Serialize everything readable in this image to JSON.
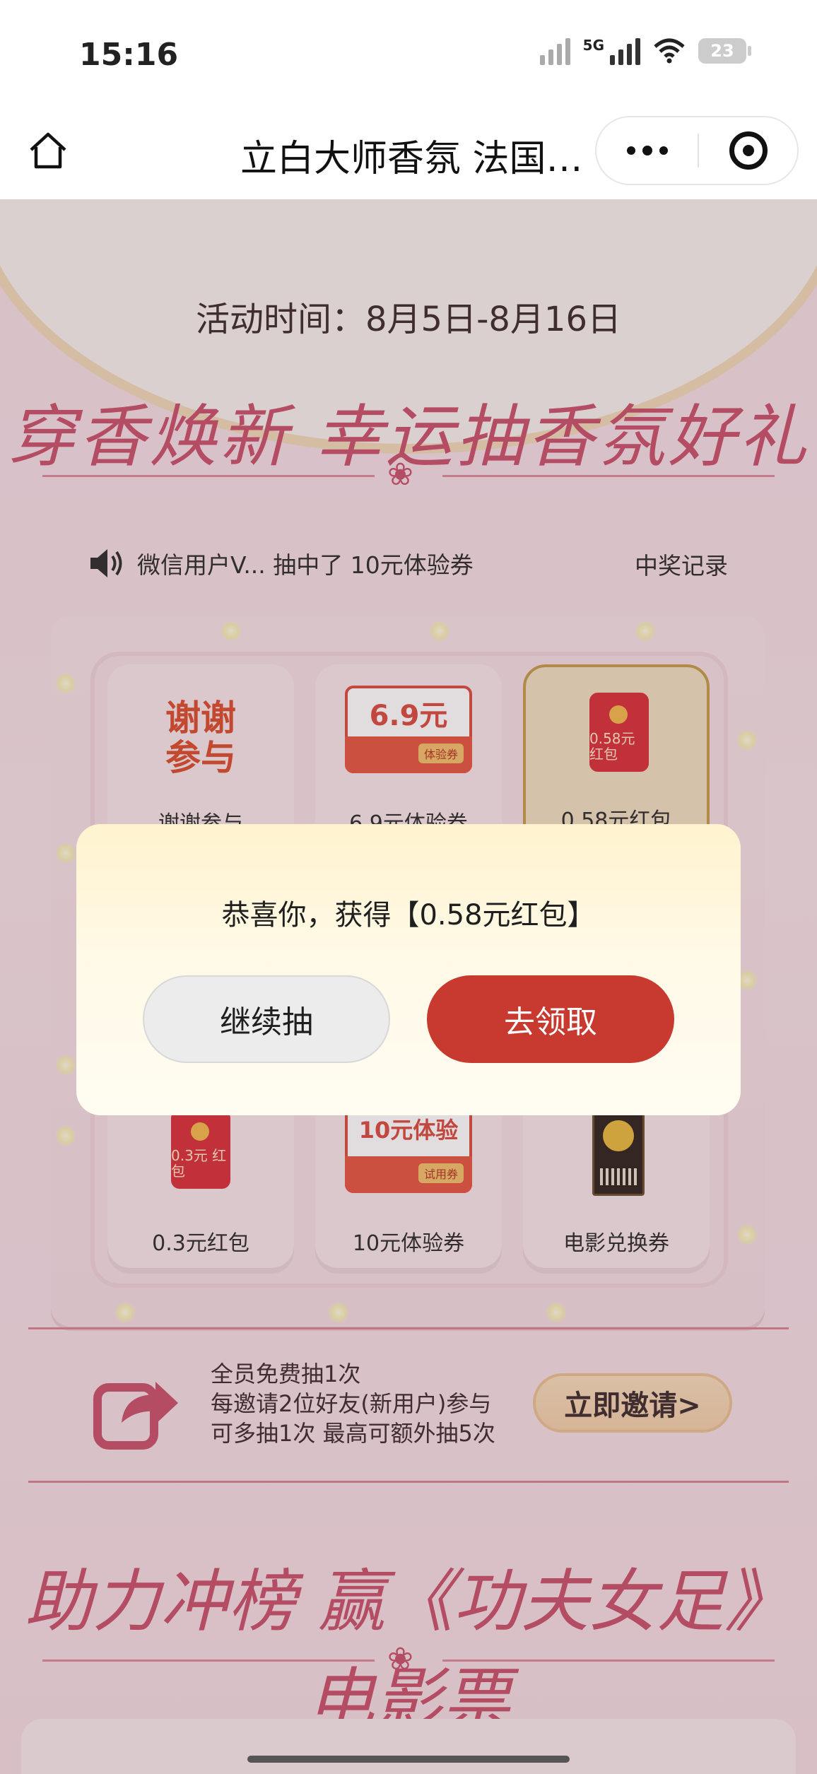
{
  "status_bar": {
    "time": "15:16",
    "network": "5G",
    "battery": "23"
  },
  "nav": {
    "title": "立白大师香氛 法国…"
  },
  "campaign": {
    "period": "活动时间：8月5日-8月16日",
    "slogan": "穿香焕新 幸运抽香氛好礼",
    "ticker": "微信用户V...  抽中了  10元体验券",
    "records_link": "中奖记录"
  },
  "prizes": {
    "thanks_art": "谢谢参与",
    "cells": [
      {
        "label": "谢谢参与"
      },
      {
        "label": "6.9元体验券",
        "amount": "6.9元",
        "tag": "体验券"
      },
      {
        "label": "0.58元红包",
        "art": "0.58元 红包"
      },
      {
        "label": "0.3元红包",
        "art": "0.3元 红包"
      },
      {
        "label": "10元体验券",
        "amount": "10元体验",
        "tag": "试用券"
      },
      {
        "label": "电影兑换券"
      }
    ]
  },
  "invite": {
    "line1": "全员免费抽1次",
    "line2": "每邀请2位好友(新用户)参与",
    "line3": "可多抽1次 最高可额外抽5次",
    "button": "立即邀请>"
  },
  "slogan2": "助力冲榜  赢《功夫女足》电影票",
  "modal": {
    "message": "恭喜你，获得【0.58元红包】",
    "continue_label": "继续抽",
    "claim_label": "去领取"
  },
  "colors": {
    "accent_red": "#c8392f",
    "brand_pink": "#c8506a"
  }
}
